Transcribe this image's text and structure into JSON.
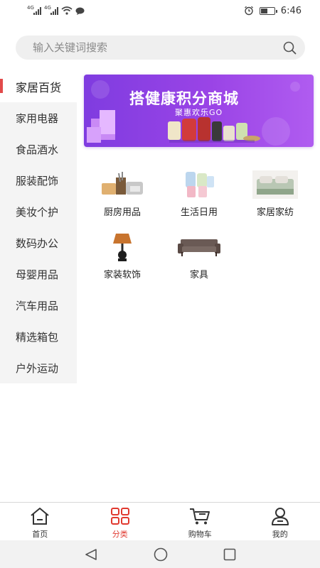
{
  "status": {
    "net1": "4G",
    "net2": "4G",
    "time": "6:46",
    "battery_level": 0.45
  },
  "search": {
    "placeholder": "输入关键词搜索"
  },
  "sidebar": {
    "items": [
      {
        "label": "家居百货",
        "active": true
      },
      {
        "label": "家用电器"
      },
      {
        "label": "食品酒水"
      },
      {
        "label": "服装配饰"
      },
      {
        "label": "美妆个护"
      },
      {
        "label": "数码办公"
      },
      {
        "label": "母婴用品"
      },
      {
        "label": "汽车用品"
      },
      {
        "label": "精选箱包"
      },
      {
        "label": "户外运动"
      }
    ]
  },
  "banner": {
    "title": "搭健康积分商城",
    "subtitle": "聚惠欢乐GO"
  },
  "categories": [
    {
      "label": "厨房用品",
      "icon": "kitchenware-icon"
    },
    {
      "label": "生活日用",
      "icon": "daily-goods-icon"
    },
    {
      "label": "家居家纺",
      "icon": "bedding-icon"
    },
    {
      "label": "家装软饰",
      "icon": "lamp-icon"
    },
    {
      "label": "家具",
      "icon": "sofa-icon"
    }
  ],
  "tabbar": {
    "items": [
      {
        "label": "首页",
        "icon": "home-icon"
      },
      {
        "label": "分类",
        "icon": "category-grid-icon",
        "active": true
      },
      {
        "label": "购物车",
        "icon": "cart-icon"
      },
      {
        "label": "我的",
        "icon": "user-icon"
      }
    ]
  },
  "colors": {
    "accent": "#e0392f",
    "banner_start": "#7f3ce0",
    "banner_end": "#b05cf0",
    "sidebar_bg": "#f4f4f4"
  }
}
